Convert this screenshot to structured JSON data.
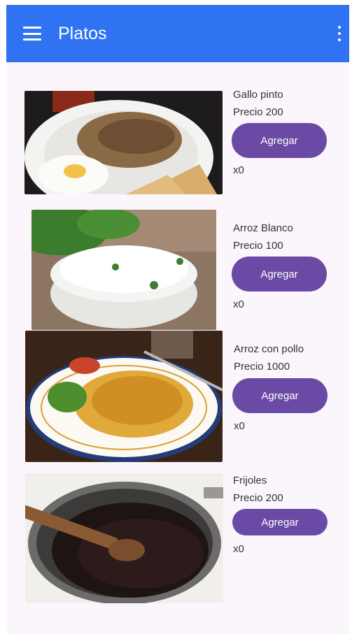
{
  "appbar": {
    "title": "Platos",
    "menu_icon": "menu-icon",
    "more_icon": "more-vert-icon",
    "color": "#2f73f2"
  },
  "button_color": "#6a4aa5",
  "dishes": [
    {
      "name": "Gallo pinto",
      "price": "Precio 200",
      "button": "Agregar",
      "count": "x0"
    },
    {
      "name": "Arroz Blanco",
      "price": "Precio 100",
      "button": "Agregar",
      "count": "x0"
    },
    {
      "name": "Arroz con pollo",
      "price": "Precio 1000",
      "button": "Agregar",
      "count": "x0"
    },
    {
      "name": "Frijoles",
      "price": "Precio 200",
      "button": "Agregar",
      "count": "x0"
    }
  ]
}
